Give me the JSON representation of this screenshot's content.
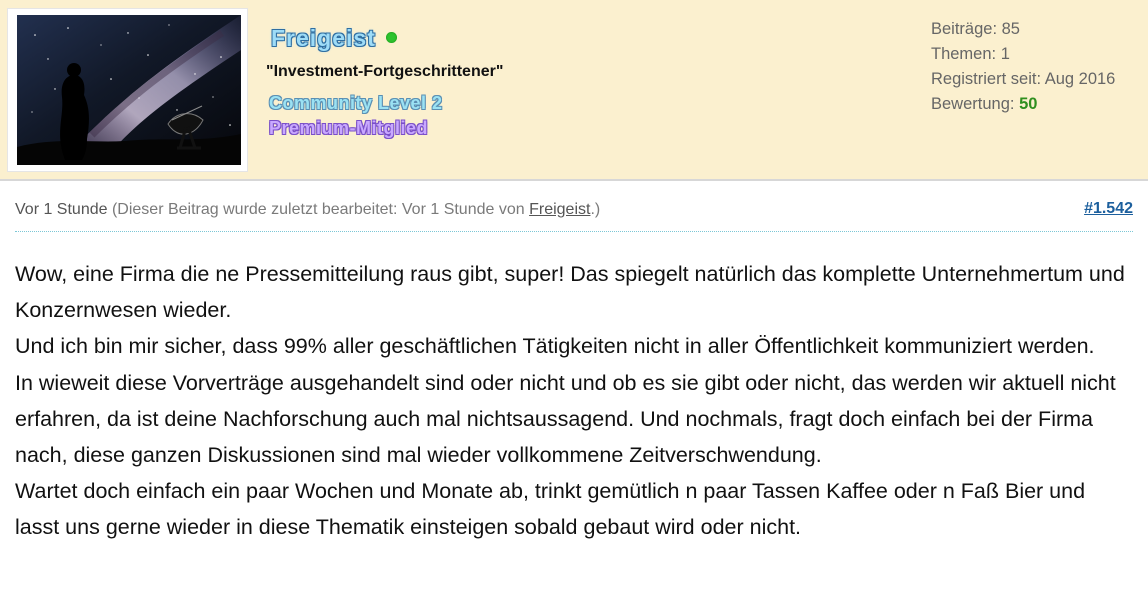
{
  "user": {
    "name": "Freigeist",
    "title": "\"Investment-Fortgeschrittener\"",
    "community_level": "Community Level 2",
    "membership": "Premium-Mitglied",
    "online_status": "online",
    "avatar_icon": "night-sky-avatar"
  },
  "stats": {
    "posts": "Beiträge: 85",
    "threads": "Themen: 1",
    "registered": "Registriert seit: Aug 2016",
    "rating_label": "Bewertung:",
    "rating_value": "50"
  },
  "meta": {
    "time": "Vor 1 Stunde",
    "edit_prefix": "(Dieser Beitrag wurde zuletzt bearbeitet: Vor 1 Stunde von",
    "editor": "Freigeist",
    "edit_suffix": ".)",
    "post_number": "#1.542"
  },
  "content": {
    "paragraphs": [
      "Wow, eine Firma die ne Pressemitteilung raus gibt, super! Das spiegelt natürlich das komplette Unternehmertum und Konzernwesen wieder.",
      "Und ich bin mir sicher, dass 99% aller geschäftlichen Tätigkeiten nicht in aller Öffentlichkeit kommuniziert werden.",
      "In wieweit diese Vorverträge ausgehandelt sind oder nicht und ob es sie gibt oder nicht, das werden wir aktuell nicht erfahren, da ist deine Nachforschung auch mal nichtsaussagend. Und nochmals, fragt doch einfach bei der Firma nach, diese ganzen Diskussionen sind mal wieder vollkommene Zeitverschwendung.",
      "Wartet doch einfach ein paar Wochen und Monate ab, trinkt gemütlich n paar Tassen Kaffee oder n Faß Bier und lasst uns gerne wieder in diese Thematik einsteigen sobald gebaut wird oder nicht."
    ]
  },
  "colors": {
    "header_background": "#fbf0cf",
    "username": "#9edcf7",
    "community_level": "#9be2f3",
    "premium": "#c9a8ff",
    "online": "#2ec32e",
    "rating": "#2f8f1f",
    "post_number": "#1c5f9d"
  }
}
